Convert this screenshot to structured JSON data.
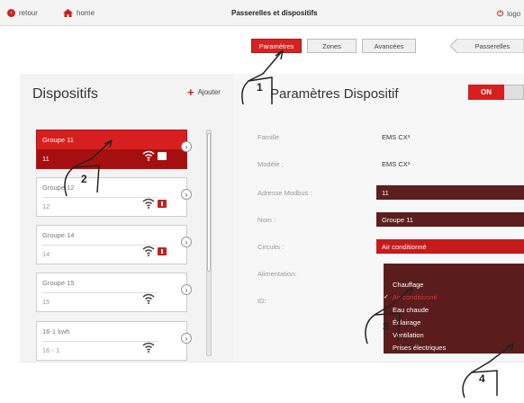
{
  "topbar": {
    "back_label": "retour",
    "home_label": "home",
    "title": "Passerelles et dispositifs",
    "logout_label": "logo"
  },
  "tabs": [
    {
      "label": "Paramètres",
      "active": true
    },
    {
      "label": "Zones",
      "active": false
    },
    {
      "label": "Avancées",
      "active": false
    },
    {
      "label": "Passerelles",
      "active": false
    }
  ],
  "left": {
    "title": "Dispositifs",
    "add_label": "Ajouter",
    "devices": [
      {
        "name": "Groupe 11",
        "code": "11",
        "selected": true
      },
      {
        "name": "Groupe 12",
        "code": "12",
        "selected": false
      },
      {
        "name": "Groupe 14",
        "code": "14",
        "selected": false
      },
      {
        "name": "Groupe 15",
        "code": "15",
        "selected": false
      },
      {
        "name": "16-1 kwh",
        "code": "16 - 1",
        "selected": false
      }
    ]
  },
  "right": {
    "title": "Paramètres Dispositif",
    "toggle_label": "ON",
    "fields": {
      "famille": {
        "label": "Famille",
        "value": "EMS CX³"
      },
      "modele": {
        "label": "Modèle :",
        "value": "EMS CX³"
      },
      "adresse": {
        "label": "Adresse Modbus :",
        "value": "11"
      },
      "nom": {
        "label": "Nom :",
        "value": "Groupe 11"
      },
      "circuits": {
        "label": "Circuits :",
        "value": "Air conditionné"
      },
      "alimentation": {
        "label": "Alimentation:"
      },
      "id": {
        "label": "ID:"
      }
    },
    "dropdown_options": [
      {
        "label": "Chauffage",
        "selected": false
      },
      {
        "label": "Air conditionné",
        "selected": true
      },
      {
        "label": "Eau chaude",
        "selected": false
      },
      {
        "label": "Éclairage",
        "selected": false
      },
      {
        "label": "Ventilation",
        "selected": false
      },
      {
        "label": "Prises électriques",
        "selected": false
      }
    ]
  },
  "callouts": [
    "1",
    "2",
    "3",
    "4"
  ],
  "colors": {
    "accent": "#d62222",
    "dark_red": "#5c1e1e",
    "field_red": "#c51b1b"
  }
}
